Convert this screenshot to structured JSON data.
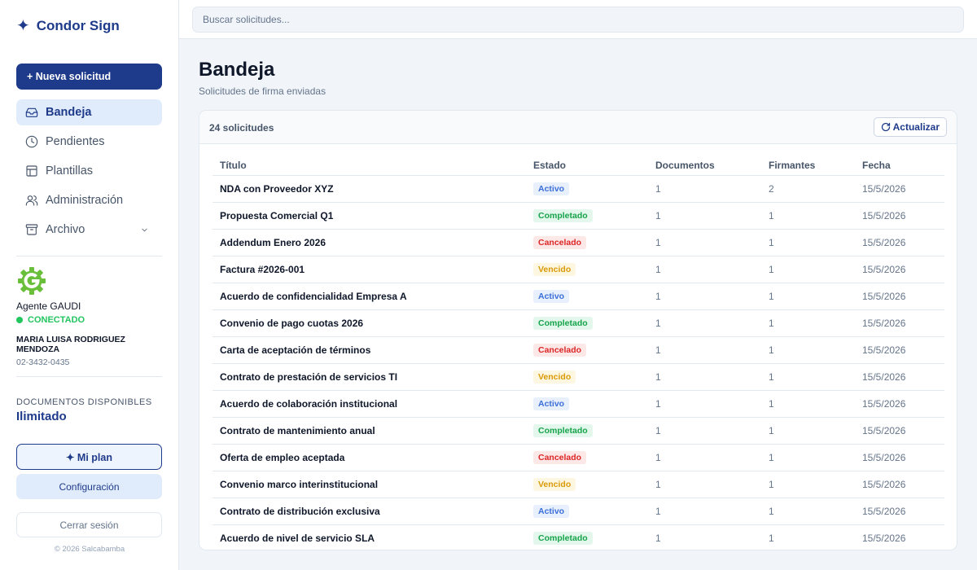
{
  "app": {
    "name": "Condor Sign"
  },
  "sidebar": {
    "new_request_label": "+ Nueva solicitud",
    "items": [
      {
        "label": "Bandeja",
        "icon": "inbox-icon",
        "active": true
      },
      {
        "label": "Pendientes",
        "icon": "clock-icon",
        "active": false
      },
      {
        "label": "Plantillas",
        "icon": "template-icon",
        "active": false
      },
      {
        "label": "Administración",
        "icon": "users-icon",
        "active": false
      },
      {
        "label": "Archivo",
        "icon": "archive-icon",
        "active": false
      }
    ],
    "agent": {
      "name": "Agente GAUDI",
      "status": "CONECTADO",
      "user_name": "MARIA LUISA RODRIGUEZ MENDOZA",
      "phone": "02-3432-0435"
    },
    "documents": {
      "label": "DOCUMENTOS DISPONIBLES",
      "value": "Ilimitado"
    },
    "plan_label": "✦ Mi plan",
    "config_label": "Configuración",
    "logout_label": "Cerrar sesión",
    "copyright": "© 2026 Salcabamba"
  },
  "search": {
    "placeholder": "Buscar solicitudes..."
  },
  "main": {
    "title": "Bandeja",
    "subtitle": "Solicitudes de firma enviadas",
    "count_label": "24 solicitudes",
    "refresh_label": "Actualizar",
    "columns": [
      "Título",
      "Estado",
      "Documentos",
      "Firmantes",
      "Fecha"
    ],
    "rows": [
      {
        "title": "NDA con Proveedor XYZ",
        "status": "Activo",
        "docs": "1",
        "signers": "2",
        "date": "15/5/2026"
      },
      {
        "title": "Propuesta Comercial Q1",
        "status": "Completado",
        "docs": "1",
        "signers": "1",
        "date": "15/5/2026"
      },
      {
        "title": "Addendum Enero 2026",
        "status": "Cancelado",
        "docs": "1",
        "signers": "1",
        "date": "15/5/2026"
      },
      {
        "title": "Factura #2026-001",
        "status": "Vencido",
        "docs": "1",
        "signers": "1",
        "date": "15/5/2026"
      },
      {
        "title": "Acuerdo de confidencialidad Empresa A",
        "status": "Activo",
        "docs": "1",
        "signers": "1",
        "date": "15/5/2026"
      },
      {
        "title": "Convenio de pago cuotas 2026",
        "status": "Completado",
        "docs": "1",
        "signers": "1",
        "date": "15/5/2026"
      },
      {
        "title": "Carta de aceptación de términos",
        "status": "Cancelado",
        "docs": "1",
        "signers": "1",
        "date": "15/5/2026"
      },
      {
        "title": "Contrato de prestación de servicios TI",
        "status": "Vencido",
        "docs": "1",
        "signers": "1",
        "date": "15/5/2026"
      },
      {
        "title": "Acuerdo de colaboración institucional",
        "status": "Activo",
        "docs": "1",
        "signers": "1",
        "date": "15/5/2026"
      },
      {
        "title": "Contrato de mantenimiento anual",
        "status": "Completado",
        "docs": "1",
        "signers": "1",
        "date": "15/5/2026"
      },
      {
        "title": "Oferta de empleo aceptada",
        "status": "Cancelado",
        "docs": "1",
        "signers": "1",
        "date": "15/5/2026"
      },
      {
        "title": "Convenio marco interinstitucional",
        "status": "Vencido",
        "docs": "1",
        "signers": "1",
        "date": "15/5/2026"
      },
      {
        "title": "Contrato de distribución exclusiva",
        "status": "Activo",
        "docs": "1",
        "signers": "1",
        "date": "15/5/2026"
      },
      {
        "title": "Acuerdo de nivel de servicio SLA",
        "status": "Completado",
        "docs": "1",
        "signers": "1",
        "date": "15/5/2026"
      }
    ]
  },
  "colors": {
    "primary": "#1e3a8a",
    "activo": "#3b6fd8",
    "completado": "#16a34a",
    "cancelado": "#dc2626",
    "vencido": "#d99a06",
    "agent_logo": "#6abf3a"
  }
}
